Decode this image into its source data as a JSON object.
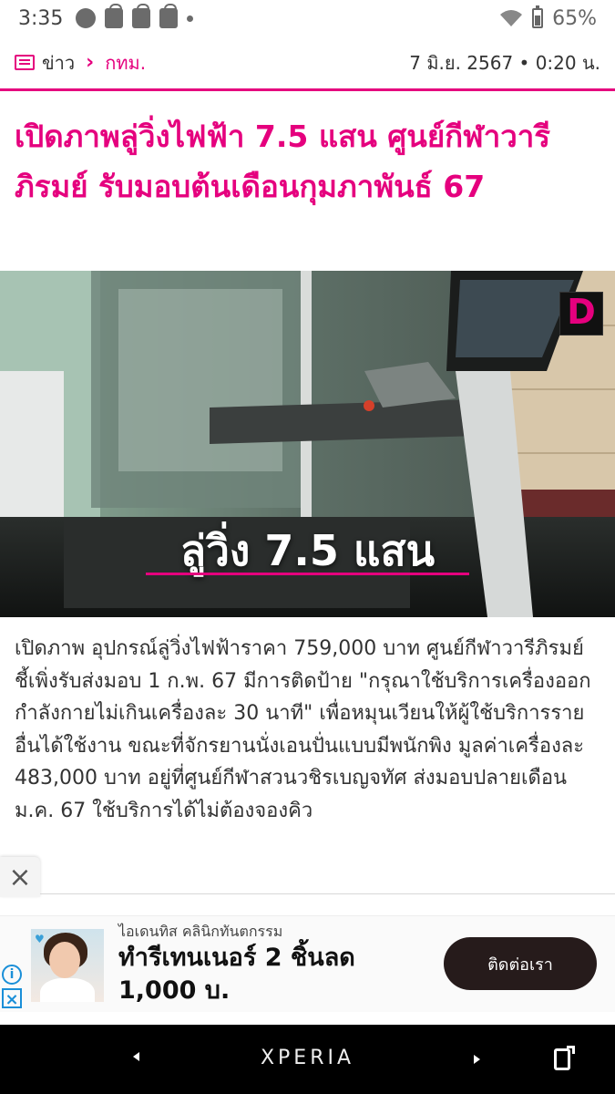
{
  "status_bar": {
    "time": "3:35",
    "battery": "65%",
    "icons": [
      "messenger-icon",
      "shopping-bag-icon",
      "sf-icon",
      "shopping-bag-icon",
      "dot-icon",
      "wifi-icon",
      "battery-icon"
    ]
  },
  "breadcrumb": {
    "home": "ข่าว",
    "category": "กทม.",
    "date": "7 มิ.ย. 2567 • 0:20 น."
  },
  "article": {
    "headline": "เปิดภาพลู่วิ่งไฟฟ้า 7.5 แสน ศูนย์กีฬาวารีภิรมย์ รับมอบต้นเดือนกุมภาพันธ์ 67",
    "hero_caption": "ลู่วิ่ง 7.5 แสน",
    "hero_logo": "D",
    "body": "เปิดภาพ อุปกรณ์ลู่วิ่งไฟฟ้าราคา 759,000 บาท ศูนย์กีฬาวารีภิรมย์ ชี้เพิ่งรับส่งมอบ 1 ก.พ. 67 มีการติดป้าย \"กรุณาใช้บริการเครื่องออกกำลังกายไม่เกินเครื่องละ 30 นาที\" เพื่อหมุนเวียนให้ผู้ใช้บริการรายอื่นได้ใช้งาน ขณะที่จักรยานนั่งเอนปั่นแบบมีพนักพิง มูลค่าเครื่องละ 483,000 บาท อยู่ที่ศูนย์กีฬาสวนวชิรเบญจทัศ ส่งมอบปลายเดือน ม.ค. 67 ใช้บริการได้ไม่ต้องจองคิว"
  },
  "ad": {
    "advertiser": "ไอเดนทิส คลินิกทันตกรรม",
    "title": "ทำรีเทนเนอร์ 2 ชิ้นลด 1,000 บ.",
    "cta": "ติดต่อเรา"
  },
  "nav_bar": {
    "brand": "XPERIA"
  },
  "colors": {
    "accent": "#e5007e",
    "cta_bg": "#261b1b",
    "nav_bg": "#000000"
  }
}
